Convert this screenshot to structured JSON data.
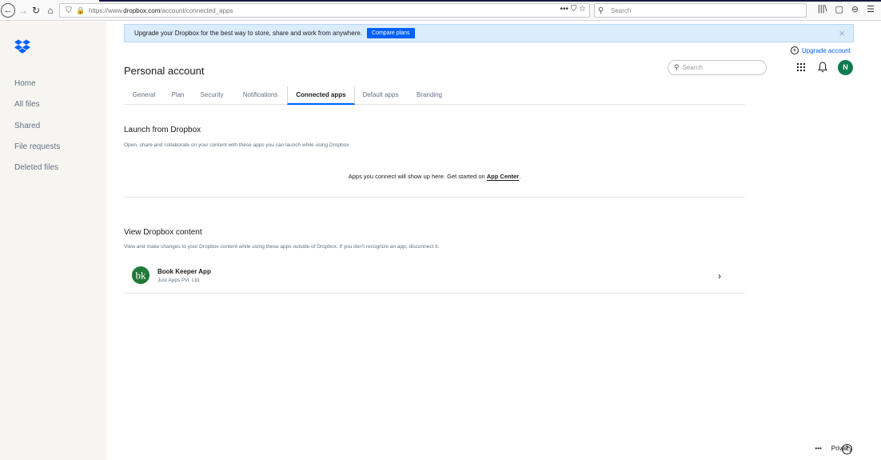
{
  "browser": {
    "url_prefix": "https://www.",
    "url_domain": "dropbox.com",
    "url_path": "/account/connected_apps",
    "search_placeholder": "Search",
    "page_actions": "••• ⛉ ☆",
    "toolbar_right": [
      "|||\\",
      "▢",
      "⊖",
      "☰"
    ]
  },
  "sidebar": {
    "items": [
      {
        "label": "Home"
      },
      {
        "label": "All files"
      },
      {
        "label": "Shared"
      },
      {
        "label": "File requests"
      },
      {
        "label": "Deleted files"
      }
    ]
  },
  "banner": {
    "message": "Upgrade your Dropbox for the best way to store, share and work from anywhere.",
    "button": "Compare plans",
    "close": "×"
  },
  "header": {
    "upgrade": "Upgrade account",
    "title": "Personal account",
    "search_placeholder": "Search",
    "avatar_initial": "N"
  },
  "tabs": [
    {
      "label": "General"
    },
    {
      "label": "Plan"
    },
    {
      "label": "Security"
    },
    {
      "label": "Notifications"
    },
    {
      "label": "Connected apps",
      "active": true
    },
    {
      "label": "Default apps"
    },
    {
      "label": "Branding"
    }
  ],
  "launch": {
    "title": "Launch from Dropbox",
    "description": "Open, share and collaborate on your content with these apps you can launch while using Dropbox",
    "empty_text": "Apps you connect will show up here. Get started on ",
    "empty_link": "App Center",
    "empty_end": "."
  },
  "view": {
    "title": "View Dropbox content",
    "description": "View and make changes to your Dropbox content while using these apps outside of Dropbox. If you don't recognize an app, disconnect it.",
    "apps": [
      {
        "icon_text": "bk",
        "name": "Book Keeper App",
        "company": "Just Apps Pvt. Ltd."
      }
    ]
  },
  "footer": {
    "more": "•••",
    "privacy": "Privacy",
    "help": "?"
  },
  "colors": {
    "accent": "#0061fe",
    "banner_bg": "#dbecfd",
    "sidebar_bg": "#f7f5f2",
    "avatar": "#0f7a4f",
    "app_icon": "#1f7a3a"
  }
}
